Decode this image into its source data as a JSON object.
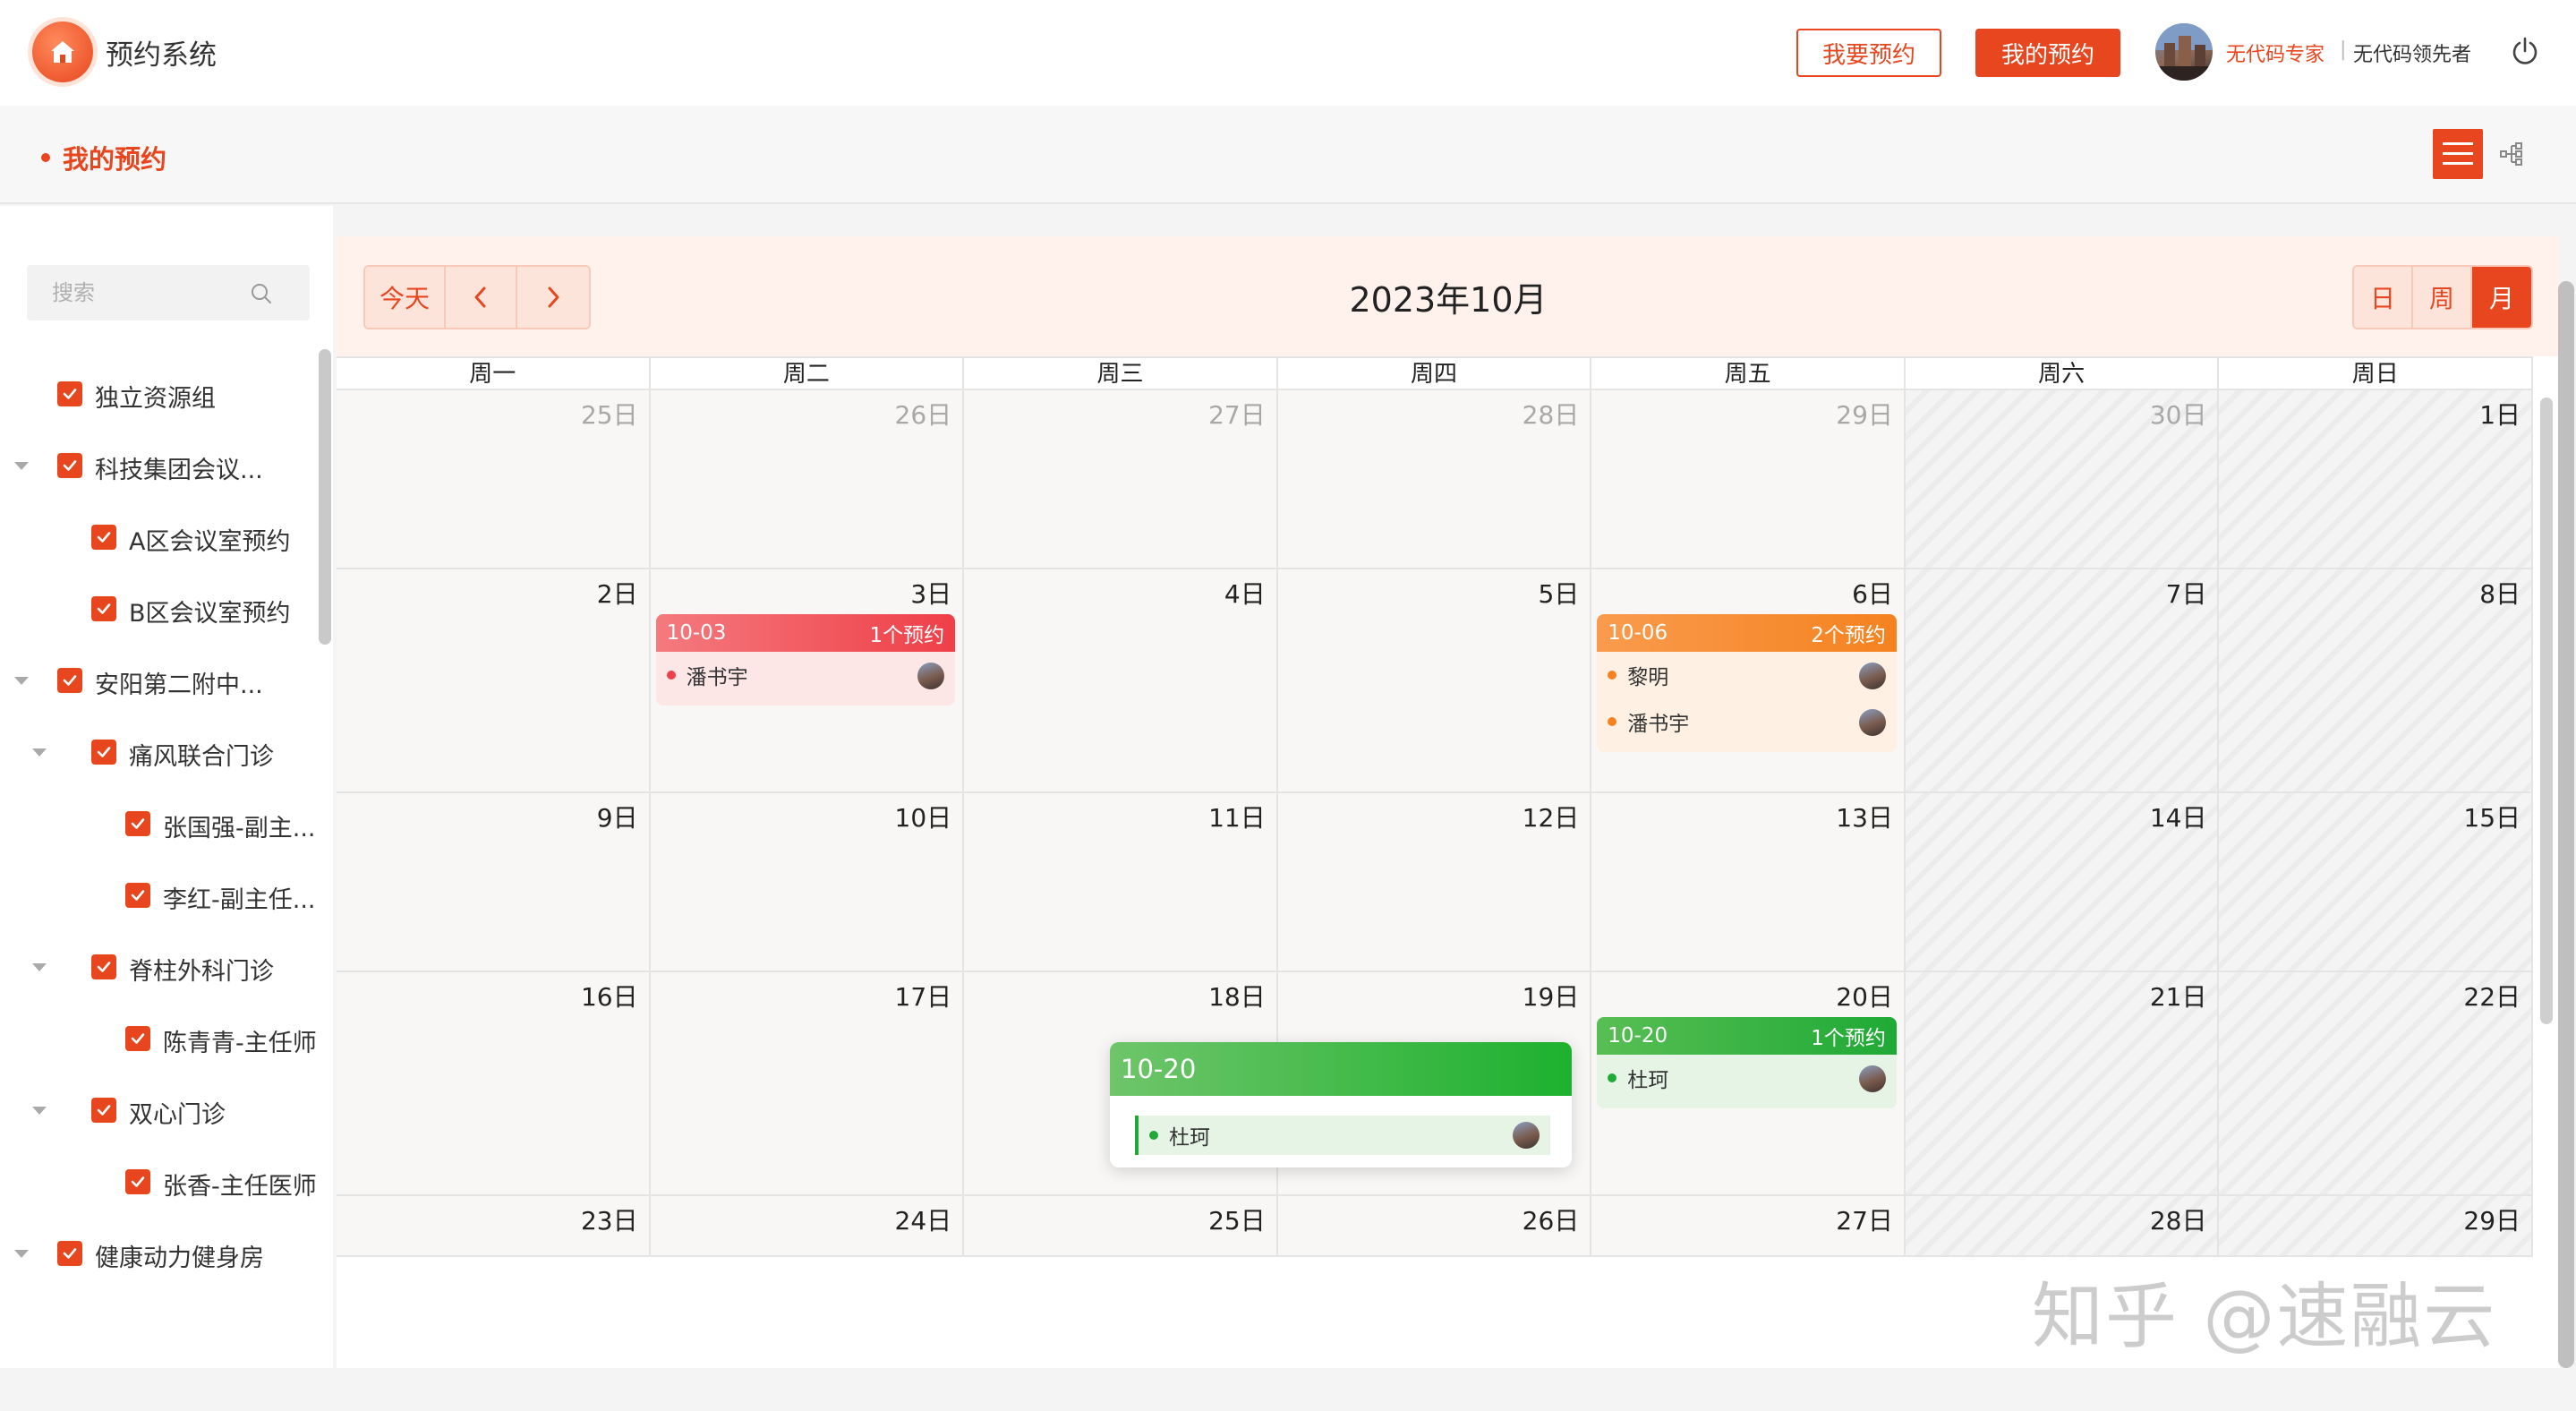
{
  "header": {
    "app_title": "预约系统",
    "btn_book": "我要预约",
    "btn_mine": "我的预约",
    "user_role": "无代码专家",
    "user_sep": "|",
    "user_name": "无代码领先者"
  },
  "subbar": {
    "title": "我的预约"
  },
  "sidebar": {
    "search_placeholder": "搜索",
    "tree": [
      {
        "label": "独立资源组",
        "level": 0,
        "caret": false
      },
      {
        "label": "科技集团会议...",
        "level": 0,
        "caret": true
      },
      {
        "label": "A区会议室预约",
        "level": 1,
        "caret": false
      },
      {
        "label": "B区会议室预约",
        "level": 1,
        "caret": false
      },
      {
        "label": "安阳第二附中...",
        "level": 0,
        "caret": true
      },
      {
        "label": "痛风联合门诊",
        "level": 1,
        "caret": true
      },
      {
        "label": "张国强-副主...",
        "level": 2,
        "caret": false
      },
      {
        "label": "李红-副主任...",
        "level": 2,
        "caret": false
      },
      {
        "label": "脊柱外科门诊",
        "level": 1,
        "caret": true
      },
      {
        "label": "陈青青-主任师",
        "level": 2,
        "caret": false
      },
      {
        "label": "双心门诊",
        "level": 1,
        "caret": true
      },
      {
        "label": "张香-主任医师",
        "level": 2,
        "caret": false
      },
      {
        "label": "健康动力健身房",
        "level": 0,
        "caret": true
      }
    ]
  },
  "calendar": {
    "title": "2023年10月",
    "btn_today": "今天",
    "modes": [
      "日",
      "周",
      "月"
    ],
    "active_mode": "月",
    "weekdays": [
      "周一",
      "周二",
      "周三",
      "周四",
      "周五",
      "周六",
      "周日"
    ],
    "weeks": [
      [
        "25日",
        "26日",
        "27日",
        "28日",
        "29日",
        "30日",
        "1日"
      ],
      [
        "2日",
        "3日",
        "4日",
        "5日",
        "6日",
        "7日",
        "8日"
      ],
      [
        "9日",
        "10日",
        "11日",
        "12日",
        "13日",
        "14日",
        "15日"
      ],
      [
        "16日",
        "17日",
        "18日",
        "19日",
        "20日",
        "21日",
        "22日"
      ],
      [
        "23日",
        "24日",
        "25日",
        "26日",
        "27日",
        "28日",
        "29日"
      ]
    ],
    "events": {
      "oct03": {
        "date": "10-03",
        "count": "1个预约",
        "items": [
          "潘书宇"
        ],
        "color": "#f0474f"
      },
      "oct06": {
        "date": "10-06",
        "count": "2个预约",
        "items": [
          "黎明",
          "潘书宇"
        ],
        "color": "#f7862f"
      },
      "oct20": {
        "date": "10-20",
        "count": "1个预约",
        "items": [
          "杜珂"
        ],
        "color": "#1faa35"
      }
    },
    "popup": {
      "date": "10-20",
      "item": "杜珂"
    }
  },
  "watermark": "知乎 @速融云",
  "colors": {
    "accent": "#e8461e",
    "red_event": "#f0474f",
    "orange_event": "#f7862f",
    "green_event": "#1faa35"
  }
}
